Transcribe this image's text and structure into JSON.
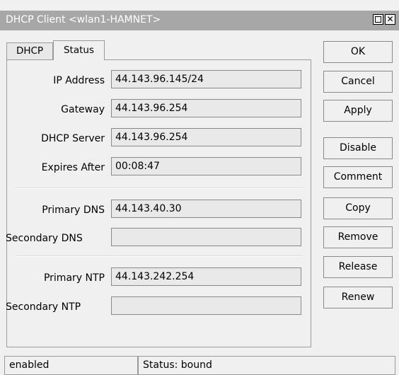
{
  "window": {
    "title": "DHCP Client <wlan1-HAMNET>"
  },
  "tabs": [
    {
      "label": "DHCP"
    },
    {
      "label": "Status"
    }
  ],
  "fields": {
    "ip_address": {
      "label": "IP Address",
      "value": "44.143.96.145/24"
    },
    "gateway": {
      "label": "Gateway",
      "value": "44.143.96.254"
    },
    "dhcp_server": {
      "label": "DHCP Server",
      "value": "44.143.96.254"
    },
    "expires_after": {
      "label": "Expires After",
      "value": "00:08:47"
    },
    "primary_dns": {
      "label": "Primary DNS",
      "value": "44.143.40.30"
    },
    "secondary_dns": {
      "label": "Secondary DNS",
      "value": ""
    },
    "primary_ntp": {
      "label": "Primary NTP",
      "value": "44.143.242.254"
    },
    "secondary_ntp": {
      "label": "Secondary NTP",
      "value": ""
    }
  },
  "buttons": {
    "ok": "OK",
    "cancel": "Cancel",
    "apply": "Apply",
    "disable": "Disable",
    "comment": "Comment",
    "copy": "Copy",
    "remove": "Remove",
    "release": "Release",
    "renew": "Renew"
  },
  "statusbar": {
    "state": "enabled",
    "status": "Status: bound"
  }
}
